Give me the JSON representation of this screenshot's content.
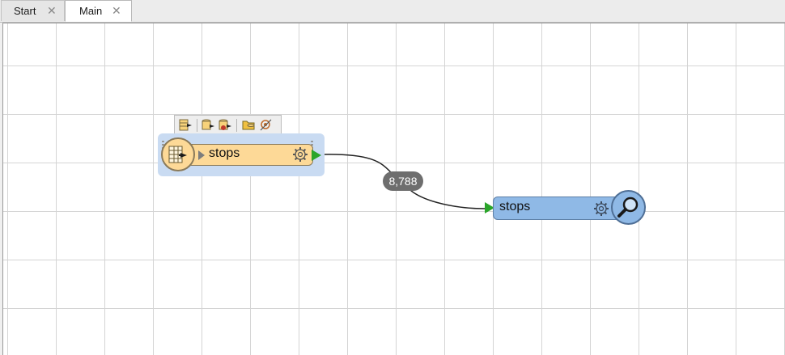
{
  "tabs": [
    {
      "label": "Start",
      "close": "✕",
      "active": false
    },
    {
      "label": "Main",
      "close": "✕",
      "active": true
    }
  ],
  "canvas": {
    "quick_toolbar": {
      "icons": [
        "run-to-this-icon",
        "run-from-this-icon",
        "run-partial-icon",
        "open-dataset-icon",
        "inspect-cached-icon"
      ]
    },
    "reader": {
      "label": "stops",
      "icon": "table-reader-icon",
      "color": "#fdd997",
      "selected": true
    },
    "connection": {
      "feature_count": "8,788"
    },
    "inspector": {
      "label": "stops",
      "icon": "magnifier-icon",
      "color": "#8fb9e6"
    },
    "port_color": "#2aa52a"
  }
}
